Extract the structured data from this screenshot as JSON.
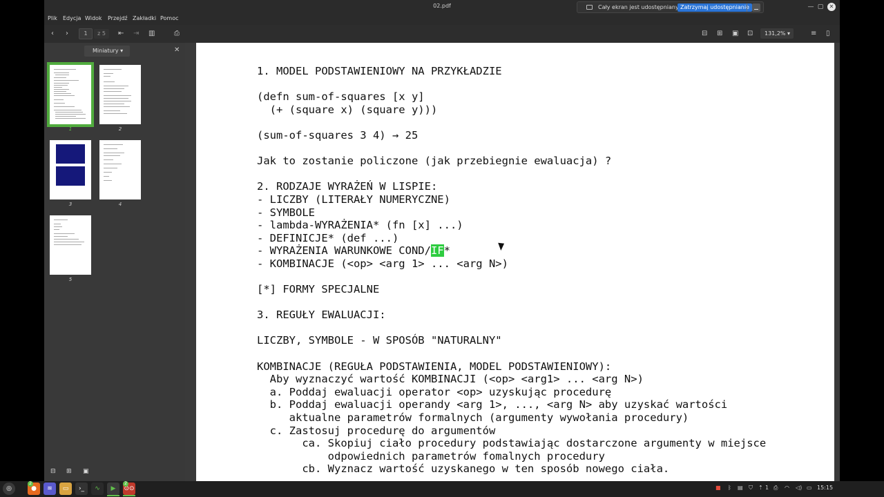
{
  "window": {
    "title": "02.pdf"
  },
  "share_bar": {
    "text": "Cały ekran jest udostępniany.",
    "stop_label": "Zatrzymaj udostępnianie"
  },
  "menu": [
    "Plik",
    "Edycja",
    "Widok",
    "Przejdź",
    "Zakładki",
    "Pomoc"
  ],
  "toolbar": {
    "page_value": "1",
    "page_total": "z 5",
    "zoom": "131,2%"
  },
  "sidebar": {
    "dropdown_label": "Miniatury",
    "thumbnails": [
      "1",
      "2",
      "3",
      "4",
      "5"
    ],
    "selected_page": 1
  },
  "document": {
    "lines": [
      "1. MODEL PODSTAWIENIOWY NA PRZYKŁADZIE",
      "",
      "(defn sum-of-squares [x y]",
      "  (+ (square x) (square y)))",
      "",
      "(sum-of-squares 3 4) → 25",
      "",
      "Jak to zostanie policzone (jak przebiegnie ewaluacja) ?",
      "",
      "2. RODZAJE WYRAŻEŃ W LISPIE:",
      "- LICZBY (LITERAŁY NUMERYCZNE)",
      "- SYMBOLE",
      "- lambda-WYRAŻENIA* (fn [x] ...)",
      "- DEFINICJE* (def ...)",
      "- WYRAŻENIA WARUNKOWE COND/IF*",
      "- KOMBINACJE (<op> <arg 1> ... <arg N>)",
      "",
      "[*] FORMY SPECJALNE",
      "",
      "3. REGUŁY EWALUACJI:",
      "",
      "LICZBY, SYMBOLE - W SPOSÓB \"NATURALNY\"",
      "",
      "KOMBINACJE (REGUŁA PODSTAWIENIA, MODEL PODSTAWIENIOWY):",
      "  Aby wyznaczyć wartość KOMBINACJI (<op> <arg1> ... <arg N>)",
      "  a. Poddaj ewaluacji operator <op> uzyskując procedurę",
      "  b. Poddaj ewaluacji operandy <arg 1>, ..., <arg N> aby uzyskać wartości",
      "     aktualne parametrów formalnych (argumenty wywołania procedury)",
      "  c. Zastosuj procedurę do argumentów",
      "       ca. Skopiuj ciało procedury podstawiając dostarczone argumenty w miejsce",
      "           odpowiednich parametrów fomalnych procedury",
      "       cb. Wyznacz wartość uzyskanego w ten sposób nowego ciała."
    ],
    "highlighted_line_index": 14,
    "highlighted_text": "IF",
    "highlight_color": "#2ecc40"
  },
  "taskbar": {
    "badges": [
      "2",
      "2"
    ],
    "tray_counter": "1",
    "clock": "15:15"
  },
  "colors": {
    "accent": "#2a74d6",
    "selection": "#51ac3e",
    "panel": "#393939"
  }
}
